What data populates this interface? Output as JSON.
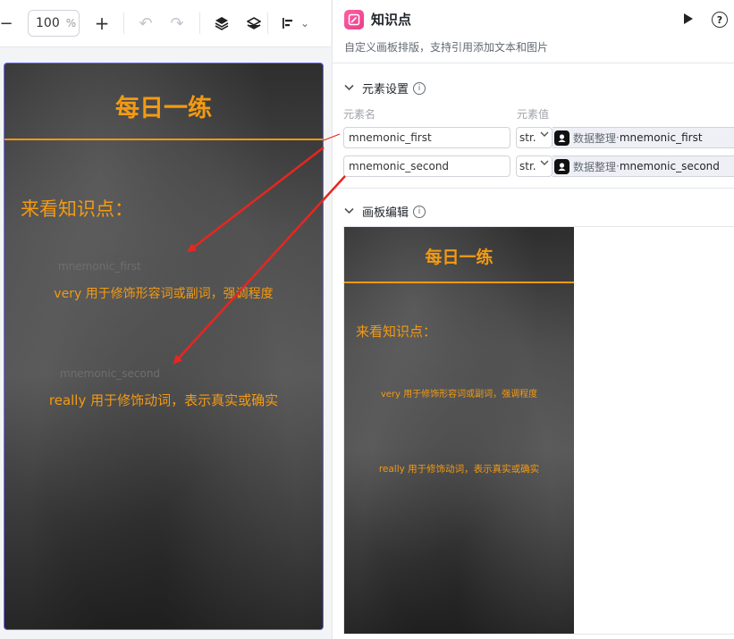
{
  "toolbar": {
    "minus_icon": "−",
    "zoom_value": "100",
    "zoom_unit": "%",
    "plus_icon": "+",
    "undo_icon": "↶",
    "redo_icon": "↷",
    "align_caret": "⌄"
  },
  "artboard": {
    "title": "每日一练",
    "subtitle": "来看知识点：",
    "ghost_first": "mnemonic_first",
    "ghost_second": "mnemonic_second",
    "text_first": "very 用于修饰形容词或副词，强调程度",
    "text_second": "really 用于修饰动词，表示真实或确实",
    "accent_color": "#f39a12",
    "arrow_color": "#e8261f"
  },
  "panel": {
    "title": "知识点",
    "description": "自定义画板排版，支持引用添加文本和图片",
    "help_label": "?",
    "elements_section": {
      "title": "元素设置",
      "info": "i",
      "col_name": "元素名",
      "col_value": "元素值",
      "rows": [
        {
          "name": "mnemonic_first",
          "type": "str.",
          "source": "数据整理",
          "sep": " · ",
          "var": "mnemonic_first"
        },
        {
          "name": "mnemonic_second",
          "type": "str.",
          "source": "数据整理",
          "sep": " · ",
          "var": "mnemonic_second"
        }
      ]
    },
    "canvas_section": {
      "title": "画板编辑",
      "info": "i"
    }
  }
}
